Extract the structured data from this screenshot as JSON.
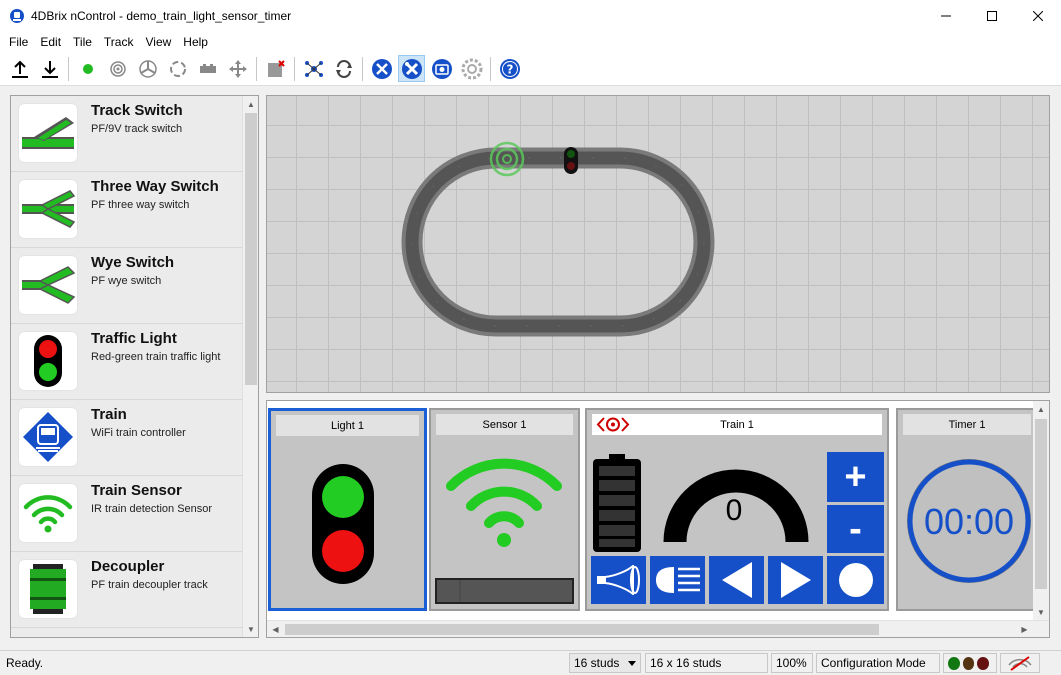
{
  "window": {
    "title": "4DBrix nControl - demo_train_light_sensor_timer"
  },
  "menu": {
    "items": [
      "File",
      "Edit",
      "Tile",
      "Track",
      "View",
      "Help"
    ]
  },
  "toolbar": {
    "icons": [
      "upload-icon",
      "download-icon",
      "green-dot-icon",
      "sensor-icon",
      "turntable-icon",
      "loop-icon",
      "brick-icon",
      "cross-icon",
      "delete-icon",
      "network-icon",
      "refresh-icon",
      "tools-icon",
      "config-mode-icon",
      "camera-icon",
      "settings-icon",
      "help-icon"
    ]
  },
  "palette": {
    "items": [
      {
        "name": "Track Switch",
        "desc": "PF/9V track switch",
        "icon": "track-switch-icon"
      },
      {
        "name": "Three Way Switch",
        "desc": "PF three way switch",
        "icon": "three-way-switch-icon"
      },
      {
        "name": "Wye Switch",
        "desc": "PF wye switch",
        "icon": "wye-switch-icon"
      },
      {
        "name": "Traffic Light",
        "desc": "Red-green train traffic light",
        "icon": "traffic-light-icon"
      },
      {
        "name": "Train",
        "desc": "WiFi train controller",
        "icon": "train-icon"
      },
      {
        "name": "Train Sensor",
        "desc": "IR train detection Sensor",
        "icon": "wifi-sensor-icon"
      },
      {
        "name": "Decoupler",
        "desc": "PF train decoupler track",
        "icon": "decoupler-icon"
      }
    ]
  },
  "tiles": {
    "light": {
      "label": "Light 1"
    },
    "sensor": {
      "label": "Sensor 1"
    },
    "train": {
      "label": "Train 1",
      "speed": "0",
      "plus": "+",
      "minus": "-"
    },
    "timer": {
      "label": "Timer 1",
      "time": "00:00"
    }
  },
  "status": {
    "ready": "Ready.",
    "studs": "16 studs",
    "grid": "16 x 16 studs",
    "zoom": "100%",
    "mode": "Configuration Mode"
  },
  "colors": {
    "accent": "#1650c8",
    "signal_green": "#22cc22",
    "signal_red": "#ee1111"
  }
}
